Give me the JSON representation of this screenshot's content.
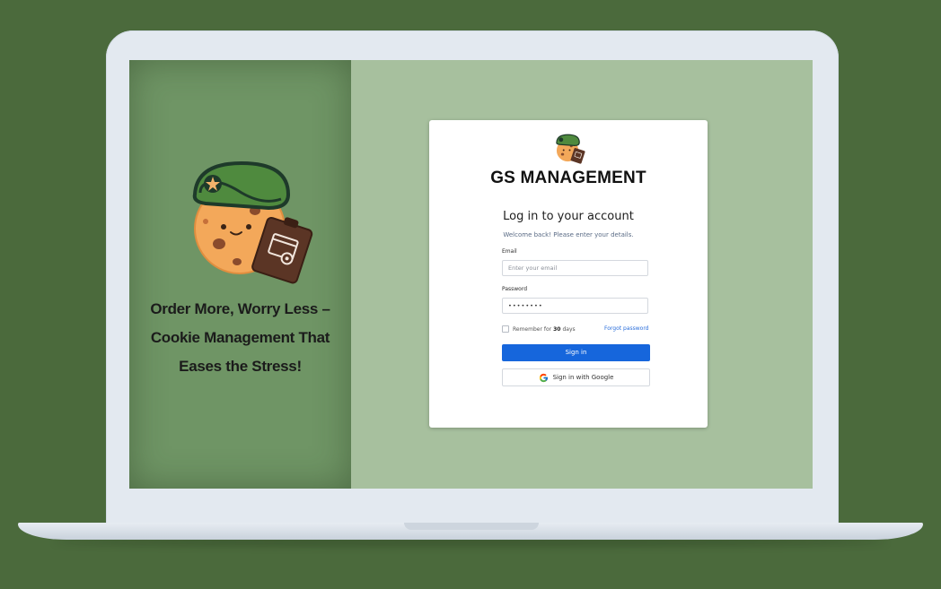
{
  "left_panel": {
    "tagline_lines": [
      "Order More, Worry Less –",
      "Cookie Management That",
      "Eases the Stress!"
    ]
  },
  "login": {
    "brand": "GS MANAGEMENT",
    "title": "Log in to your account",
    "subtitle": "Welcome back! Please enter your details.",
    "email_label": "Email",
    "email_placeholder": "Enter your email",
    "password_label": "Password",
    "password_value": "••••••••",
    "remember_prefix": "Remember for",
    "remember_days": "30",
    "remember_suffix": "days",
    "forgot_label": "Forgot password",
    "signin_label": "Sign in",
    "google_label": "Sign in with Google"
  },
  "colors": {
    "background": "#4b6a3c",
    "screen": "#a7c09e",
    "left_panel": "#6f9565",
    "primary_button": "#1666dc",
    "link": "#2a6edb"
  },
  "icons": {
    "mascot": "cookie-soldier-mascot-icon",
    "google": "google-g-icon"
  }
}
